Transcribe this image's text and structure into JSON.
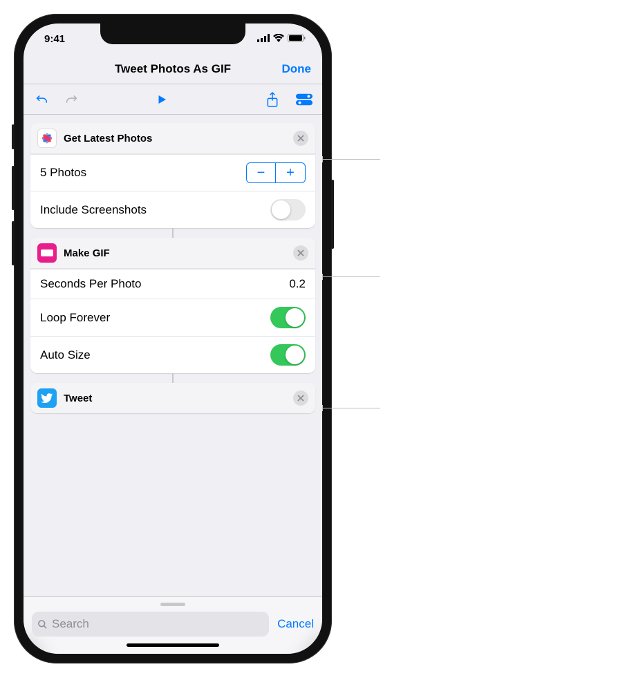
{
  "status": {
    "time": "9:41"
  },
  "nav": {
    "title": "Tweet Photos As GIF",
    "done": "Done"
  },
  "actions": [
    {
      "icon": "photos",
      "title": "Get Latest Photos",
      "rows": [
        {
          "label": "5 Photos",
          "control": "stepper"
        },
        {
          "label": "Include Screenshots",
          "control": "switch",
          "on": false
        }
      ]
    },
    {
      "icon": "gif",
      "title": "Make GIF",
      "rows": [
        {
          "label": "Seconds Per Photo",
          "control": "value",
          "value": "0.2"
        },
        {
          "label": "Loop Forever",
          "control": "switch",
          "on": true
        },
        {
          "label": "Auto Size",
          "control": "switch",
          "on": true
        }
      ]
    },
    {
      "icon": "twitter",
      "title": "Tweet",
      "rows": []
    }
  ],
  "search": {
    "placeholder": "Search",
    "cancel": "Cancel"
  }
}
